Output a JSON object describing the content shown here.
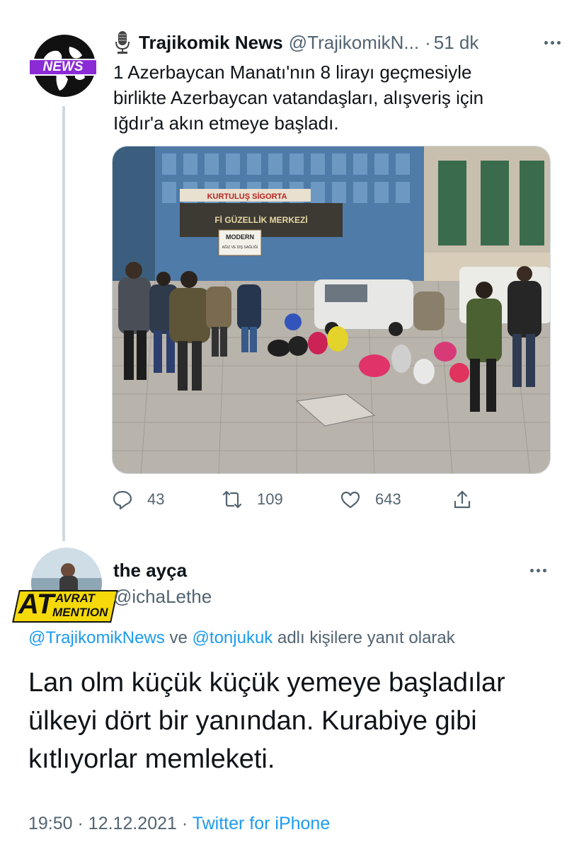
{
  "tweet": {
    "author_name": "Trajikomik News",
    "author_handle": "@TrajikomikN...",
    "separator": "·",
    "time": "51 dk",
    "avatar_label": "NEWS",
    "text_lines": [
      "1 Azerbaycan Manatı'nın 8 lirayı geçmesiyle",
      "birlikte Azerbaycan vatandaşları, alışveriş için",
      "Iğdır'a akın etmeye başladı."
    ],
    "photo_signs": {
      "building_sign": "KURTULUŞ SİGORTA",
      "mall_sign": "Fİ GÜZELLİK MERKEZİ",
      "clinic_sign_1": "MODERN",
      "clinic_sign_2": "AĞIZ VE DİŞ SAĞLIĞI"
    },
    "actions": {
      "reply_count": "43",
      "retweet_count": "109",
      "like_count": "643"
    }
  },
  "reply": {
    "author_name": "the ayça",
    "author_handle": "@ichaLethe",
    "avatar_badge_big": "AT",
    "avatar_badge_top": "AVRAT",
    "avatar_badge_bottom": "MENTION",
    "reply_to_user1": "@TrajikomikNews",
    "reply_to_joiner": "ve",
    "reply_to_user2": "@tonjukuk",
    "reply_to_suffix": "adlı kişilere yanıt olarak",
    "text_lines": [
      "Lan olm küçük küçük yemeye başladılar",
      "ülkeyi dört bir yanından. Kurabiye gibi",
      "kıtlıyorlar memleketi."
    ],
    "time": "19:50",
    "sep1": "·",
    "date": "12.12.2021",
    "sep2": "·",
    "source": "Twitter for iPhone"
  },
  "colors": {
    "link": "#1d9bf0",
    "secondary_text": "#536471",
    "thread_line": "#cfd9de",
    "news_badge": "#8a2bd6"
  }
}
